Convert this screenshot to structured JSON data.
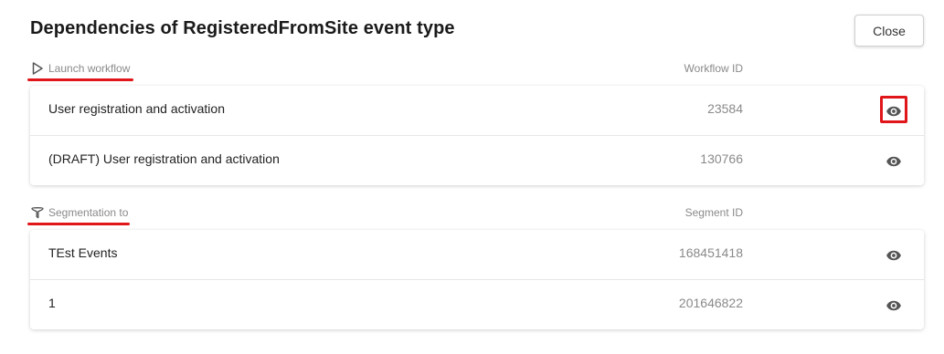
{
  "dialog": {
    "title": "Dependencies of RegisteredFromSite event type",
    "close_label": "Close"
  },
  "workflows": {
    "section_label": "Launch workflow",
    "icon": "play-outline-icon",
    "column_label": "Workflow ID",
    "rows": [
      {
        "name": "User registration and activation",
        "id": "23584"
      },
      {
        "name": "(DRAFT) User registration and activation",
        "id": "130766"
      }
    ]
  },
  "segments": {
    "section_label": "Segmentation to",
    "icon": "filter-funnel-icon",
    "column_label": "Segment ID",
    "rows": [
      {
        "name": "TEst Events",
        "id": "168451418"
      },
      {
        "name": "1",
        "id": "201646822"
      }
    ]
  },
  "colors": {
    "highlight": "#e0161a",
    "muted_text": "#8a8a8a"
  }
}
